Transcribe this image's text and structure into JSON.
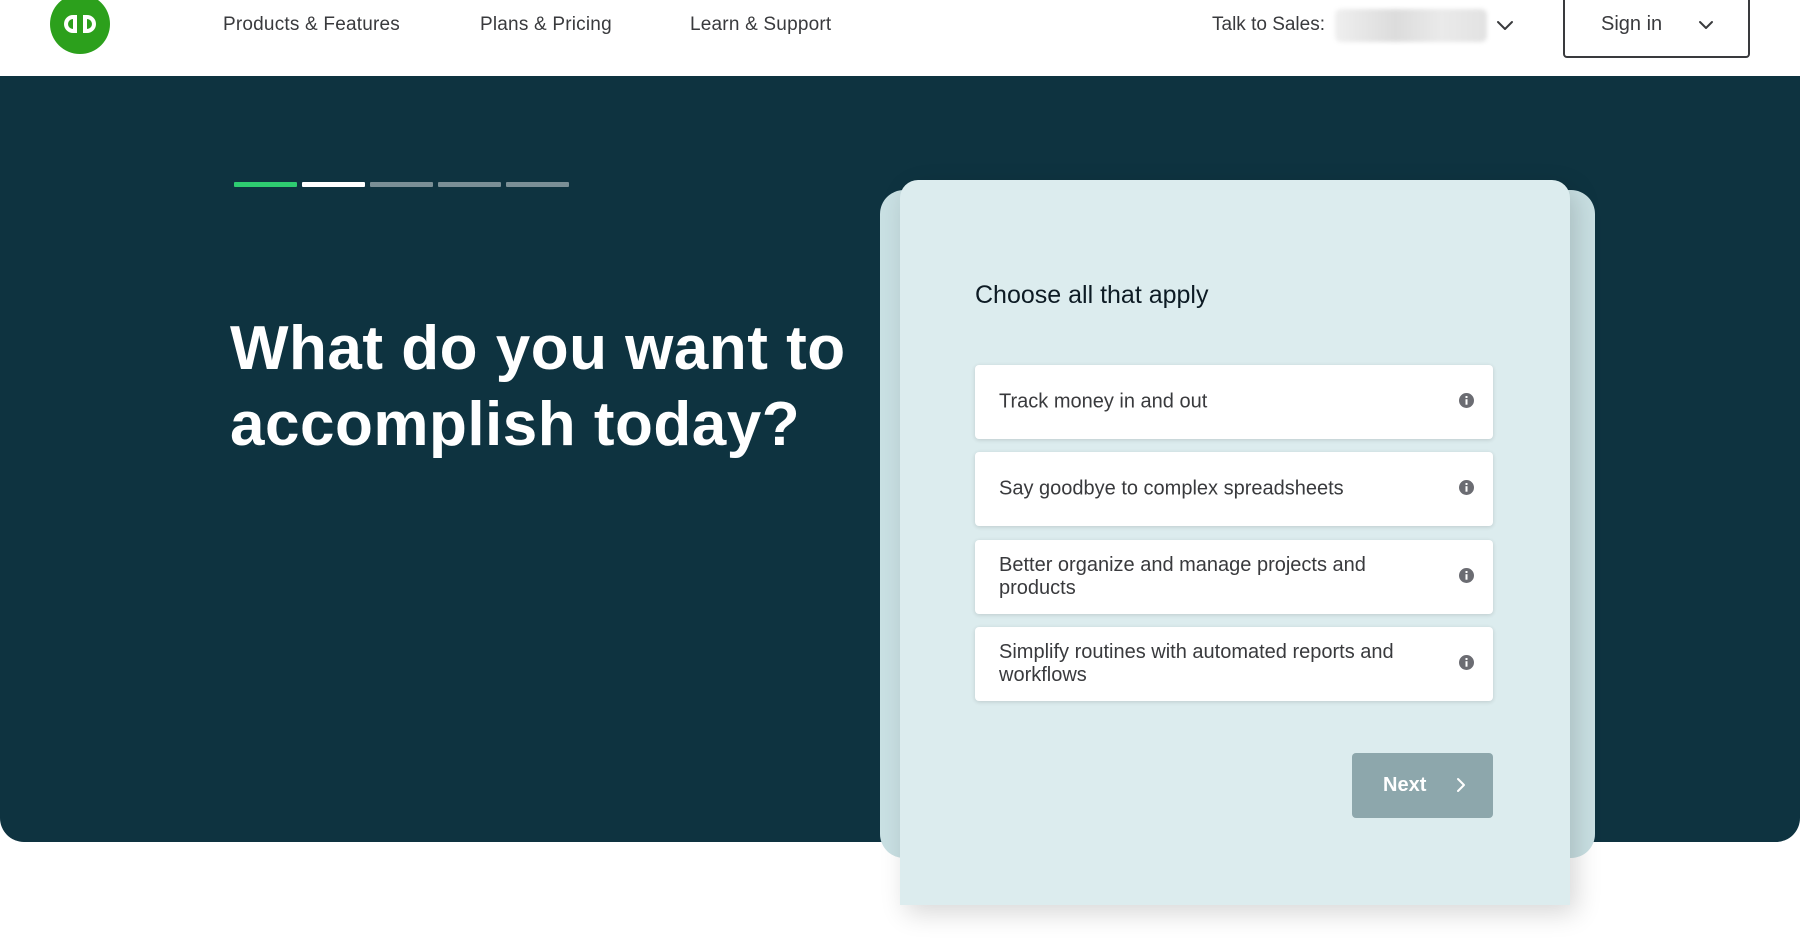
{
  "brand": {
    "logo_icon": "quickbooks-logo-icon",
    "brand_color": "#2ca01c"
  },
  "nav": {
    "items": [
      {
        "label": "Products & Features"
      },
      {
        "label": "Plans & Pricing"
      },
      {
        "label": "Learn & Support"
      }
    ],
    "talk_to_sales_label": "Talk to Sales:",
    "sign_in_label": "Sign in"
  },
  "hero": {
    "background_color": "#0e3340",
    "progress": {
      "current_step": 1,
      "total_steps": 5,
      "active_color": "#2ecc71"
    },
    "headline": "What do you want to accomplish today?"
  },
  "quiz": {
    "prompt": "Choose all that apply",
    "options": [
      {
        "label": "Track money in and out",
        "icon": "info-icon"
      },
      {
        "label": "Say goodbye to complex spreadsheets",
        "icon": "info-icon"
      },
      {
        "label": "Better organize and manage projects and products",
        "icon": "info-icon"
      },
      {
        "label": "Simplify routines with automated reports and workflows",
        "icon": "info-icon"
      }
    ],
    "next_label": "Next",
    "next_color": "#8da7ac"
  }
}
